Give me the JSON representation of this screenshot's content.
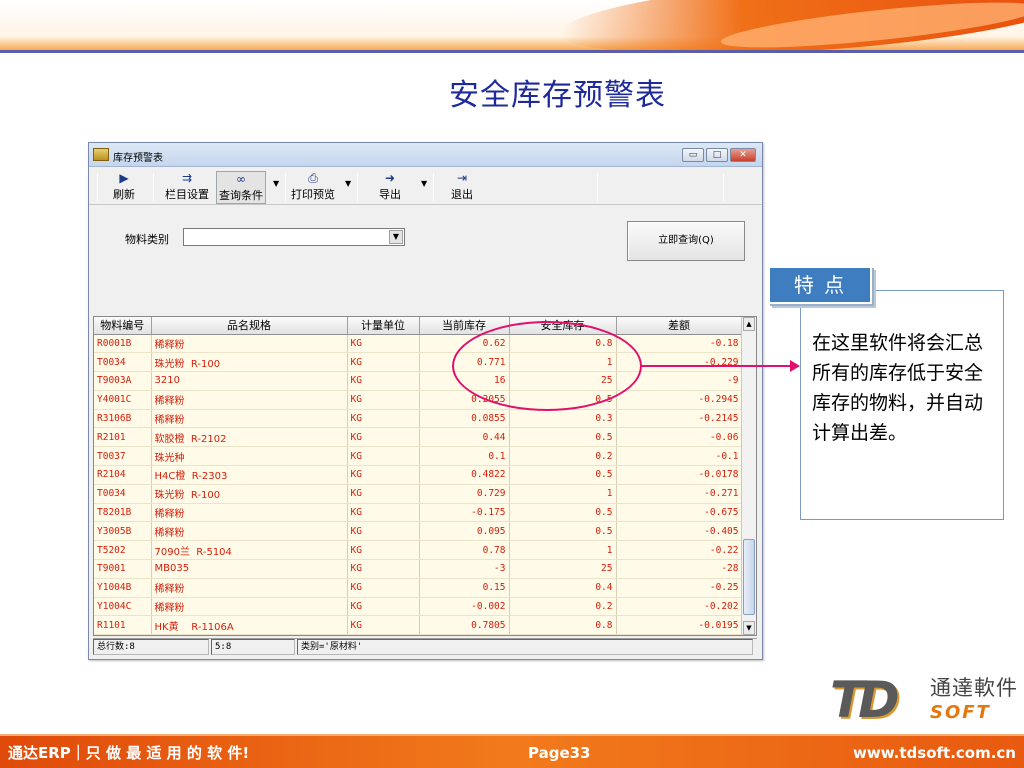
{
  "slide_title": "安全库存预警表",
  "window": {
    "title": "库存预警表",
    "controls": {
      "minimize": "▭",
      "maximize": "□",
      "close": "✕"
    }
  },
  "toolbar": {
    "refresh": "刷新",
    "column_settings": "栏目设置",
    "query_conditions": "查询条件",
    "print_preview": "打印预览",
    "export": "导出",
    "exit": "退出"
  },
  "filter": {
    "category_label": "物料类别",
    "category_value": "",
    "query_button": "立即查询(Q)"
  },
  "table": {
    "columns": [
      "物料编号",
      "品名规格",
      "计量单位",
      "当前库存",
      "安全库存",
      "差额"
    ],
    "rows": [
      [
        "R0001B",
        "稀释粉",
        "KG",
        "0.62",
        "0.8",
        "-0.18"
      ],
      [
        "T0034",
        "珠光粉  R-100",
        "KG",
        "0.771",
        "1",
        "-0.229"
      ],
      [
        "T9003A",
        "3210",
        "KG",
        "16",
        "25",
        "-9"
      ],
      [
        "Y4001C",
        "稀释粉",
        "KG",
        "0.2055",
        "0.5",
        "-0.2945"
      ],
      [
        "R3106B",
        "稀释粉",
        "KG",
        "0.0855",
        "0.3",
        "-0.2145"
      ],
      [
        "R2101",
        "软胶橙  R-2102",
        "KG",
        "0.44",
        "0.5",
        "-0.06"
      ],
      [
        "T0037",
        "珠光种",
        "KG",
        "0.1",
        "0.2",
        "-0.1"
      ],
      [
        "R2104",
        "H4C橙  R-2303",
        "KG",
        "0.4822",
        "0.5",
        "-0.0178"
      ],
      [
        "T0034",
        "珠光粉  R-100",
        "KG",
        "0.729",
        "1",
        "-0.271"
      ],
      [
        "T8201B",
        "稀释粉",
        "KG",
        "-0.175",
        "0.5",
        "-0.675"
      ],
      [
        "Y3005B",
        "稀释粉",
        "KG",
        "0.095",
        "0.5",
        "-0.405"
      ],
      [
        "T5202",
        "7090兰  R-5104",
        "KG",
        "0.78",
        "1",
        "-0.22"
      ],
      [
        "T9001",
        "MB035",
        "KG",
        "-3",
        "25",
        "-28"
      ],
      [
        "Y1004B",
        "稀释粉",
        "KG",
        "0.15",
        "0.4",
        "-0.25"
      ],
      [
        "Y1004C",
        "稀释粉",
        "KG",
        "-0.002",
        "0.2",
        "-0.202"
      ],
      [
        "R1101",
        "HK黄    R-1106A",
        "KG",
        "0.7805",
        "0.8",
        "-0.0195"
      ]
    ]
  },
  "status": {
    "total_rows": "总行数:8",
    "position": "5:8",
    "category": "类别='原材料'"
  },
  "feature": {
    "tag": "特 点",
    "text": "在这里软件将会汇总所有的库存低于安全库存的物料，并自动计算出差。"
  },
  "logo": {
    "mark": "TD",
    "cn_name": "通達軟件",
    "soft": "SOFT"
  },
  "footer": {
    "left": "通达ERP｜只 做 最 适 用 的 软 件!",
    "page": "Page33",
    "url": "www.tdsoft.com.cn"
  },
  "colors": {
    "title": "#1f2a9a",
    "grid_text": "#d4200c",
    "callout": "#e0106c",
    "tag_bg": "#3e7ec0",
    "footer_bg": "#e85a10"
  },
  "icons": [
    "refresh-icon",
    "columns-icon",
    "binoculars-icon",
    "printer-icon",
    "export-icon",
    "exit-icon",
    "app-icon"
  ]
}
